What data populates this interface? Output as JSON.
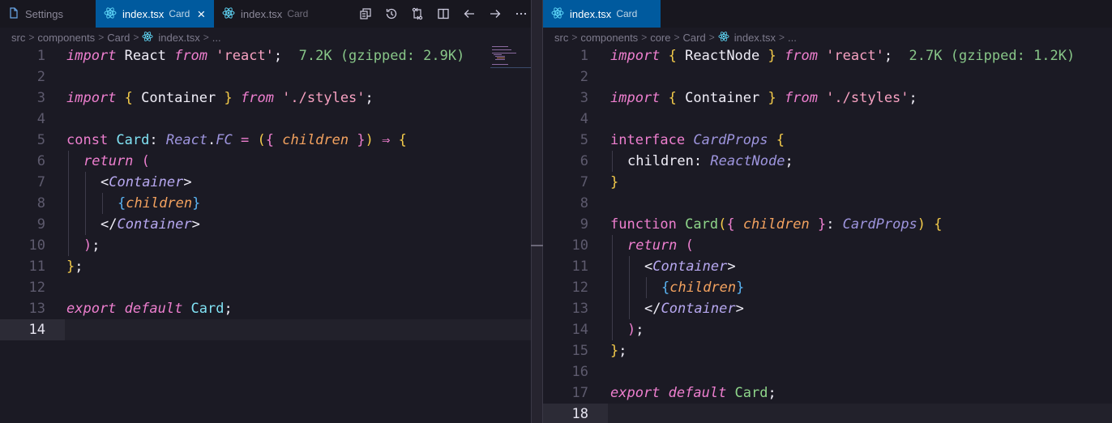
{
  "left": {
    "tabs": [
      {
        "label": "Settings",
        "desc": ""
      },
      {
        "label": "index.tsx",
        "desc": "Card"
      },
      {
        "label": "index.tsx",
        "desc": "Card"
      }
    ],
    "breadcrumb": [
      "src",
      "components",
      "Card",
      "index.tsx",
      "..."
    ],
    "current_line": 14
  },
  "right": {
    "tabs": [
      {
        "label": "index.tsx",
        "desc": "Card"
      }
    ],
    "breadcrumb": [
      "src",
      "components",
      "core",
      "Card",
      "index.tsx",
      "..."
    ],
    "current_line": 18
  },
  "left_code": {
    "l1_import": "import",
    "l1_react": " React ",
    "l1_from": "from",
    "l1_str": " 'react'",
    "l1_semi": ";",
    "l1_size": "  7.2K (gzipped: 2.9K)",
    "l3_import": "import",
    "l3_lb": " {",
    "l3_container": " Container ",
    "l3_rb": "}",
    "l3_from": " from",
    "l3_str": " './styles'",
    "l3_semi": ";",
    "l5_const": "const",
    "l5_card": " Card",
    "l5_colon": ": ",
    "l5_react": "React",
    "l5_dot": ".",
    "l5_fc": "FC",
    "l5_eq": " = ",
    "l5_lp": "(",
    "l5_lb": "{",
    "l5_children": " children ",
    "l5_rb": "}",
    "l5_rp": ")",
    "l5_arrow": " ⇒ ",
    "l5_open": "{",
    "l6_return": "return",
    "l6_lp": " (",
    "l7_lt": "<",
    "l7_tag": "Container",
    "l7_gt": ">",
    "l8_lb": "{",
    "l8_children": "children",
    "l8_rb": "}",
    "l9_lt": "</",
    "l9_tag": "Container",
    "l9_gt": ">",
    "l10_rp": ")",
    "l10_semi": ";",
    "l11_rb": "}",
    "l11_semi": ";",
    "l13_export": "export",
    "l13_default": " default",
    "l13_card": " Card",
    "l13_semi": ";"
  },
  "right_code": {
    "l1_import": "import",
    "l1_lb": " {",
    "l1_rn": " ReactNode ",
    "l1_rb": "}",
    "l1_from": " from",
    "l1_str": " 'react'",
    "l1_semi": ";",
    "l1_size": "  2.7K (gzipped: 1.2K)",
    "l3_import": "import",
    "l3_lb": " {",
    "l3_container": " Container ",
    "l3_rb": "}",
    "l3_from": " from",
    "l3_str": " './styles'",
    "l3_semi": ";",
    "l5_interface": "interface",
    "l5_name": " CardProps",
    "l5_lb": " {",
    "l6_children": "children",
    "l6_colon": ": ",
    "l6_type": "ReactNode",
    "l6_semi": ";",
    "l7_rb": "}",
    "l9_function": "function",
    "l9_card": " Card",
    "l9_lp": "(",
    "l9_lb": "{",
    "l9_children": " children ",
    "l9_rb": "}",
    "l9_colon": ": ",
    "l9_type": "CardProps",
    "l9_rp": ")",
    "l9_open": " {",
    "l10_return": "return",
    "l10_lp": " (",
    "l11_lt": "<",
    "l11_tag": "Container",
    "l11_gt": ">",
    "l12_lb": "{",
    "l12_children": "children",
    "l12_rb": "}",
    "l13_lt": "</",
    "l13_tag": "Container",
    "l13_gt": ">",
    "l14_rp": ")",
    "l14_semi": ";",
    "l15_rb": "}",
    "l15_semi": ";",
    "l17_export": "export",
    "l17_default": " default",
    "l17_card": " Card",
    "l17_semi": ";"
  },
  "line_numbers_left": [
    "1",
    "2",
    "3",
    "4",
    "5",
    "6",
    "7",
    "8",
    "9",
    "10",
    "11",
    "12",
    "13",
    "14"
  ],
  "line_numbers_right": [
    "1",
    "2",
    "3",
    "4",
    "5",
    "6",
    "7",
    "8",
    "9",
    "10",
    "11",
    "12",
    "13",
    "14",
    "15",
    "16",
    "17",
    "18"
  ],
  "colors": {
    "active_tab": "#005a9e",
    "editor_bg": "#1b1a24",
    "keyword": "#ee7fcf",
    "string": "#f7a1c1",
    "class": "#81e2f4",
    "size_hint": "#88c688"
  }
}
